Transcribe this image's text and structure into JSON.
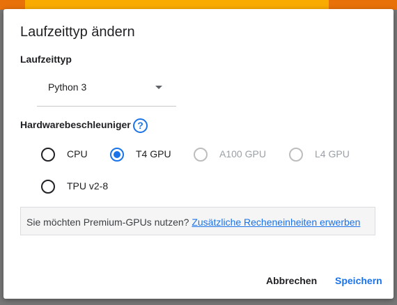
{
  "dialog": {
    "title": "Laufzeittyp ändern"
  },
  "runtime": {
    "label": "Laufzeittyp",
    "selected": "Python 3"
  },
  "hardware": {
    "label": "Hardwarebeschleuniger",
    "help_icon": "?",
    "options": [
      {
        "label": "CPU",
        "checked": false,
        "disabled": false
      },
      {
        "label": "T4 GPU",
        "checked": true,
        "disabled": false
      },
      {
        "label": "A100 GPU",
        "checked": false,
        "disabled": true
      },
      {
        "label": "L4 GPU",
        "checked": false,
        "disabled": true
      },
      {
        "label": "TPU v2-8",
        "checked": false,
        "disabled": false
      }
    ]
  },
  "premium": {
    "text": "Sie möchten Premium-GPUs nutzen? ",
    "link": "Zusätzliche Recheneinheiten erwerben"
  },
  "buttons": {
    "cancel": "Abbrechen",
    "save": "Speichern"
  },
  "colors": {
    "accent": "#1a73e8",
    "top_bar": "#f9ab00"
  }
}
